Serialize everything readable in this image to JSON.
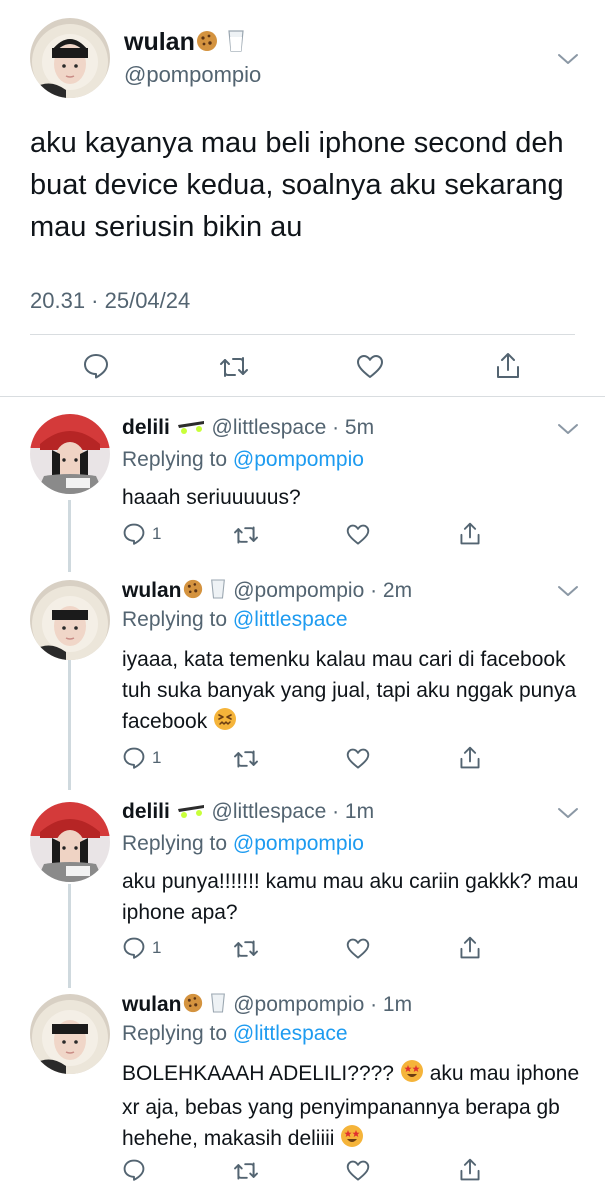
{
  "colors": {
    "text": "#0f1419",
    "muted": "#536471",
    "link": "#1d9bf0",
    "divider": "#d9dde0"
  },
  "main_tweet": {
    "name": "wulan",
    "name_emojis": [
      "cookie-emoji",
      "milk-glass-emoji"
    ],
    "handle": "@pompompio",
    "text": "aku kayanya mau beli iphone second deh buat device kedua, soalnya aku sekarang mau seriusin bikin au",
    "timestamp": "20.31 · 25/04/24",
    "actions": [
      "reply-icon",
      "retweet-icon",
      "like-icon",
      "share-icon"
    ]
  },
  "replies": [
    {
      "name": "delili",
      "name_emoji": "skateboard-emoji",
      "handle": "@littlespace",
      "time": "5m",
      "replying_prefix": "Replying to",
      "replying_to": "@pompompio",
      "text": "haaah seriuuuuus?",
      "reply_count": "1"
    },
    {
      "name": "wulan",
      "name_emoji": "cookie-milk-emoji",
      "handle": "@pompompio",
      "time": "2m",
      "replying_prefix": "Replying to",
      "replying_to": "@littlespace",
      "text": "iyaaa, kata temenku kalau mau cari di facebook tuh suka banyak yang jual, tapi aku nggak punya facebook",
      "text_emoji": "confounded-face-emoji",
      "reply_count": "1"
    },
    {
      "name": "delili",
      "name_emoji": "skateboard-emoji",
      "handle": "@littlespace",
      "time": "1m",
      "replying_prefix": "Replying to",
      "replying_to": "@pompompio",
      "text": "aku punya!!!!!!! kamu mau aku cariin gakkk? mau iphone apa?",
      "reply_count": "1"
    },
    {
      "name": "wulan",
      "name_emoji": "cookie-milk-emoji",
      "handle": "@pompompio",
      "time": "1m",
      "replying_prefix": "Replying to",
      "replying_to": "@littlespace",
      "text_part1": "BOLEHKAAAH ADELILI????",
      "text_part2": "aku mau iphone xr aja, bebas yang penyimpanannya berapa gb hehehe, makasih deliiii",
      "text_emoji": "star-struck-emoji"
    }
  ]
}
